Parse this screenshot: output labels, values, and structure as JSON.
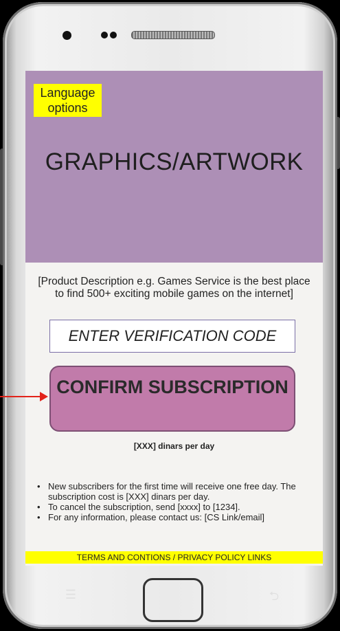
{
  "screen": {
    "language_options": "Language options",
    "hero_text": "GRAPHICS/ARTWORK",
    "description": "[Product Description e.g. Games Service is the best place to find 500+ exciting mobile games on the internet]",
    "verification_placeholder": "ENTER VERIFICATION CODE",
    "confirm_label": "CONFIRM SUBSCRIPTION",
    "price_text": "[XXX] dinars per day",
    "terms": [
      "New subscribers for the first time will receive one free day. The subscription cost is [XXX] dinars per day.",
      "To cancel the subscription, send [xxxx] to [1234].",
      "For any information, please contact us: [CS Link/email]"
    ],
    "footer_links": "TERMS AND CONTIONS / PRIVACY POLICY LINKS"
  },
  "colors": {
    "hero_bg": "#ad8fb6",
    "highlight_yellow": "#ffff00",
    "confirm_bg": "#c17baa",
    "arrow": "#e2231a"
  },
  "icons": {
    "arrow": "red-arrow-icon",
    "home": "home-button-icon",
    "menu": "menu-key-icon",
    "back": "back-key-icon"
  }
}
